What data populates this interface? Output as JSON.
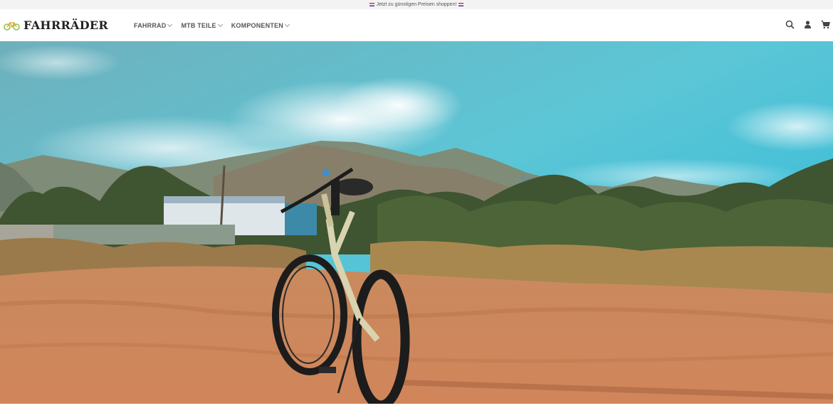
{
  "announcement": {
    "text": "Jetzt zu günstigen Preisen shoppen!"
  },
  "header": {
    "logo_text": "FAHRRÄDER",
    "nav": [
      {
        "label": "FAHRRAD"
      },
      {
        "label": "MTB TEILE"
      },
      {
        "label": "KOMPONENTEN"
      }
    ],
    "icons": [
      "search-icon",
      "account-icon",
      "cart-icon"
    ]
  },
  "hero": {
    "image": "mountain bike on dirt road with mountains and blue sky"
  },
  "colors": {
    "accent": "#8bc34a",
    "text": "#222222",
    "nav": "#555555"
  }
}
